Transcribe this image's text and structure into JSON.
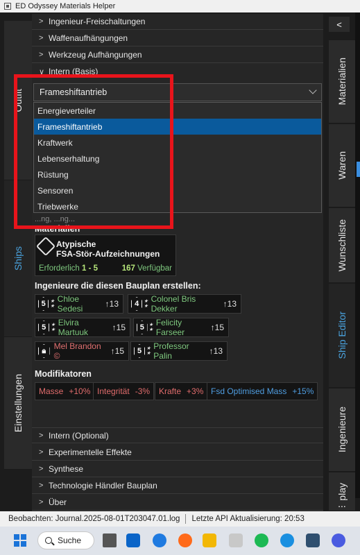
{
  "window": {
    "title": "ED Odyssey Materials Helper"
  },
  "left_tabs": {
    "outfit": "Outfit",
    "ships": "Ships",
    "settings": "Einstellungen"
  },
  "right_tabs": {
    "collapse": "<",
    "materials": "Materialien",
    "goods": "Waren",
    "wishlist": "Wunschliste",
    "ship_editor": "Ship Editor",
    "engineers": "Ingenieure",
    "display": "play",
    "more": "..."
  },
  "accordion_top": [
    "Ingenieur-Freischaltungen",
    "Waffenaufhängungen",
    "Werkzeug Aufhängungen",
    "Intern (Basis)"
  ],
  "select": {
    "value": "Frameshiftantrieb",
    "options": [
      "Energieverteiler",
      "Frameshiftantrieb",
      "Kraftwerk",
      "Lebenserhaltung",
      "Rüstung",
      "Sensoren",
      "Triebwerke"
    ],
    "selected_index": 1
  },
  "partial_line": "...ng, ...ng...",
  "materials_section": {
    "title": "Materialien",
    "card": {
      "name_line1": "Atypische",
      "name_line2": "FSA-Stör-Aufzeichnungen",
      "required_label": "Erforderlich",
      "required_value": "1 - 5",
      "available_value": "167",
      "available_label": "Verfügbar"
    }
  },
  "engineers_section": {
    "title": "Ingenieure die diesen Bauplan erstellen:",
    "engineers": [
      {
        "grade": "5",
        "name": "Chloe Sedesi",
        "dist": "13",
        "locked": false
      },
      {
        "grade": "4",
        "name": "Colonel Bris Dekker",
        "dist": "13",
        "locked": false
      },
      {
        "grade": "5",
        "name": "Elvira Martuuk",
        "dist": "15",
        "locked": false
      },
      {
        "grade": "5",
        "name": "Felicity Farseer",
        "dist": "15",
        "locked": false
      },
      {
        "grade": "",
        "name": "Mel Brandon ©",
        "dist": "15",
        "locked": true
      },
      {
        "grade": "5",
        "name": "Professor Palin",
        "dist": "13",
        "locked": false
      }
    ]
  },
  "modifiers_section": {
    "title": "Modifikatoren",
    "modifiers": [
      {
        "label": "Masse",
        "value": "+10%",
        "tone": "bad"
      },
      {
        "label": "Integrität",
        "value": "-3%",
        "tone": "bad"
      },
      {
        "label": "Krafte",
        "value": "+3%",
        "tone": "bad"
      },
      {
        "label": "Fsd Optimised Mass",
        "value": "+15%",
        "tone": "good"
      }
    ]
  },
  "accordion_bottom": [
    "Intern (Optional)",
    "Experimentelle Effekte",
    "Synthese",
    "Technologie Händler Bauplan",
    "Über"
  ],
  "statusbar": {
    "watching": "Beobachten: Journal.2025-08-01T203047.01.log",
    "last_api": "Letzte API Aktualisierung: 20:53"
  },
  "taskbar": {
    "search_label": "Suche"
  },
  "colors": {
    "accent_blue": "#4aa3df",
    "selection": "#0a5a9c",
    "positive_green": "#7fc97f",
    "negative_red": "#e06c6c",
    "highlight_frame": "#e8141b"
  }
}
